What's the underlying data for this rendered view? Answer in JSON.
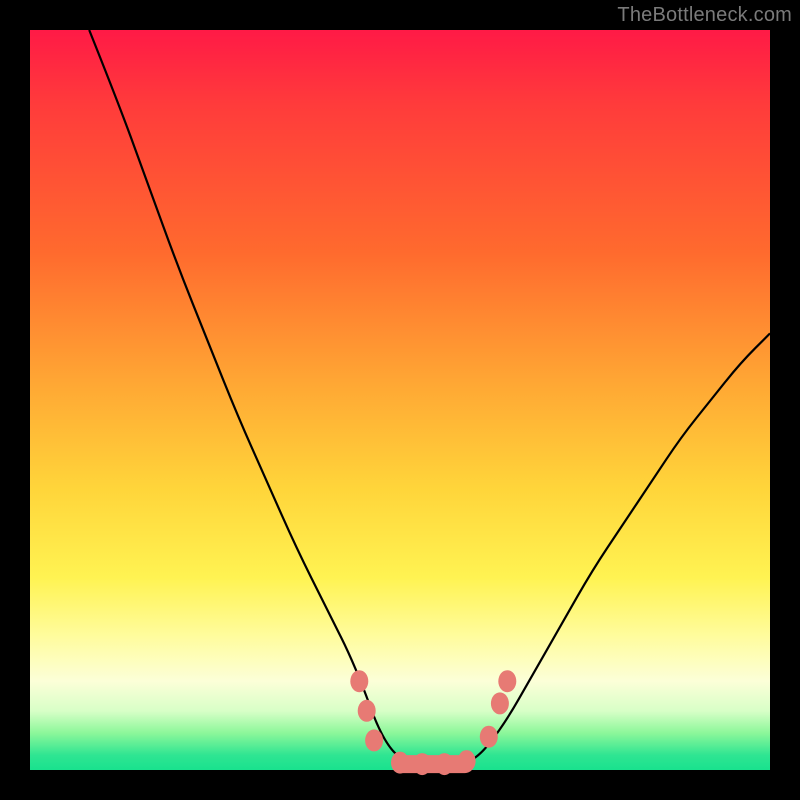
{
  "watermark": "TheBottleneck.com",
  "colors": {
    "gradient_top": "#ff1a46",
    "gradient_mid1": "#ffa834",
    "gradient_mid2": "#fff352",
    "gradient_bottom": "#19e28e",
    "curve": "#000000",
    "markers": "#e77a74",
    "frame": "#000000"
  },
  "chart_data": {
    "type": "line",
    "title": "",
    "xlabel": "",
    "ylabel": "",
    "xlim": [
      0,
      100
    ],
    "ylim": [
      0,
      100
    ],
    "grid": false,
    "comment": "V-shaped bottleneck curve; y≈0 around x≈48–60. Values are visual estimates in % of plot area (x right, y up).",
    "series": [
      {
        "name": "bottleneck-curve",
        "x": [
          8,
          12,
          16,
          20,
          24,
          28,
          32,
          36,
          40,
          44,
          48,
          52,
          56,
          60,
          64,
          68,
          72,
          76,
          80,
          84,
          88,
          92,
          96,
          100
        ],
        "y": [
          100,
          90,
          79,
          68,
          58,
          48,
          39,
          30,
          22,
          14,
          3,
          0.5,
          0.5,
          1,
          6,
          13,
          20,
          27,
          33,
          39,
          45,
          50,
          55,
          59
        ]
      }
    ],
    "markers": {
      "name": "highlight-dots",
      "comment": "salmon rounded markers near the trough",
      "points": [
        {
          "x": 44.5,
          "y": 12
        },
        {
          "x": 45.5,
          "y": 8
        },
        {
          "x": 46.5,
          "y": 4
        },
        {
          "x": 50,
          "y": 1
        },
        {
          "x": 53,
          "y": 0.8
        },
        {
          "x": 56,
          "y": 0.8
        },
        {
          "x": 59,
          "y": 1.2
        },
        {
          "x": 62,
          "y": 4.5
        },
        {
          "x": 63.5,
          "y": 9
        },
        {
          "x": 64.5,
          "y": 12
        }
      ]
    }
  }
}
